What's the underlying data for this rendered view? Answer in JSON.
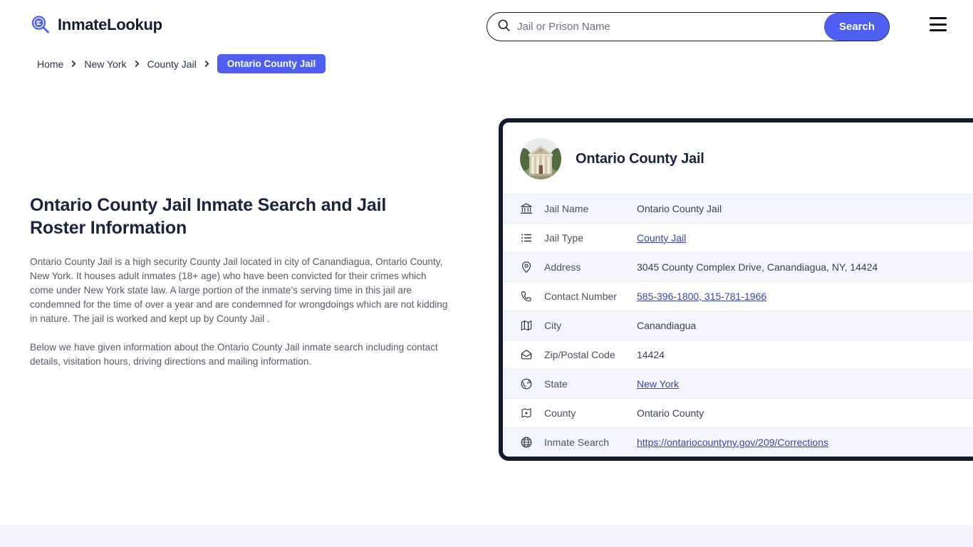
{
  "brand": {
    "name": "InmateLookup",
    "logo_icon": "magnifier-list-icon",
    "accent_color": "#4f5ff2"
  },
  "search": {
    "placeholder": "Jail or Prison Name",
    "value": "",
    "button_label": "Search",
    "icon": "search-icon"
  },
  "menu": {
    "icon": "hamburger-menu-icon",
    "label": "Menu"
  },
  "breadcrumb": {
    "items": [
      {
        "label": "Home",
        "current": false
      },
      {
        "label": "New York",
        "current": false
      },
      {
        "label": "County Jail",
        "current": false
      },
      {
        "label": "Ontario County Jail",
        "current": true
      }
    ],
    "separator_icon": "chevron-right-icon"
  },
  "article": {
    "heading": "Ontario County Jail Inmate Search and Jail Roster Information",
    "paragraphs": [
      "Ontario County Jail is a high security County Jail located in city of Canandiagua, Ontario County, New York. It houses adult inmates (18+ age) who have been convicted for their crimes which come under New York state law. A large portion of the inmate's serving time in this jail are condemned for the time of over a year and are condemned for wrongdoings which are not kidding in nature. The jail is worked and kept up by County Jail .",
      "Below we have given information about the Ontario County Jail inmate search including contact details, visitation hours, driving directions and mailing information."
    ]
  },
  "card": {
    "title": "Ontario County Jail",
    "avatar_alt": "Ontario County Jail courthouse photo",
    "border_color": "#131b2e",
    "rows": [
      {
        "icon": "bank-icon",
        "label": "Jail Name",
        "value": "Ontario County Jail",
        "link": false,
        "shaded": true
      },
      {
        "icon": "list-icon",
        "label": "Jail Type",
        "value": "County Jail",
        "link": true,
        "shaded": false
      },
      {
        "icon": "map-pin-icon",
        "label": "Address",
        "value": "3045 County Complex Drive, Canandiagua, NY, 14424",
        "link": false,
        "shaded": true
      },
      {
        "icon": "phone-icon",
        "label": "Contact Number",
        "value": "585-396-1800, 315-781-1966",
        "link": true,
        "shaded": false
      },
      {
        "icon": "map-icon",
        "label": "City",
        "value": "Canandiagua",
        "link": false,
        "shaded": true
      },
      {
        "icon": "envelope-icon",
        "label": "Zip/Postal Code",
        "value": "14424",
        "link": false,
        "shaded": false
      },
      {
        "icon": "globe-state-icon",
        "label": "State",
        "value": "New York",
        "link": true,
        "shaded": true
      },
      {
        "icon": "county-map-icon",
        "label": "County",
        "value": "Ontario County",
        "link": false,
        "shaded": false
      },
      {
        "icon": "globe-icon",
        "label": "Inmate Search",
        "value": "https://ontariocountyny.gov/209/Corrections",
        "link": true,
        "shaded": true
      }
    ]
  }
}
